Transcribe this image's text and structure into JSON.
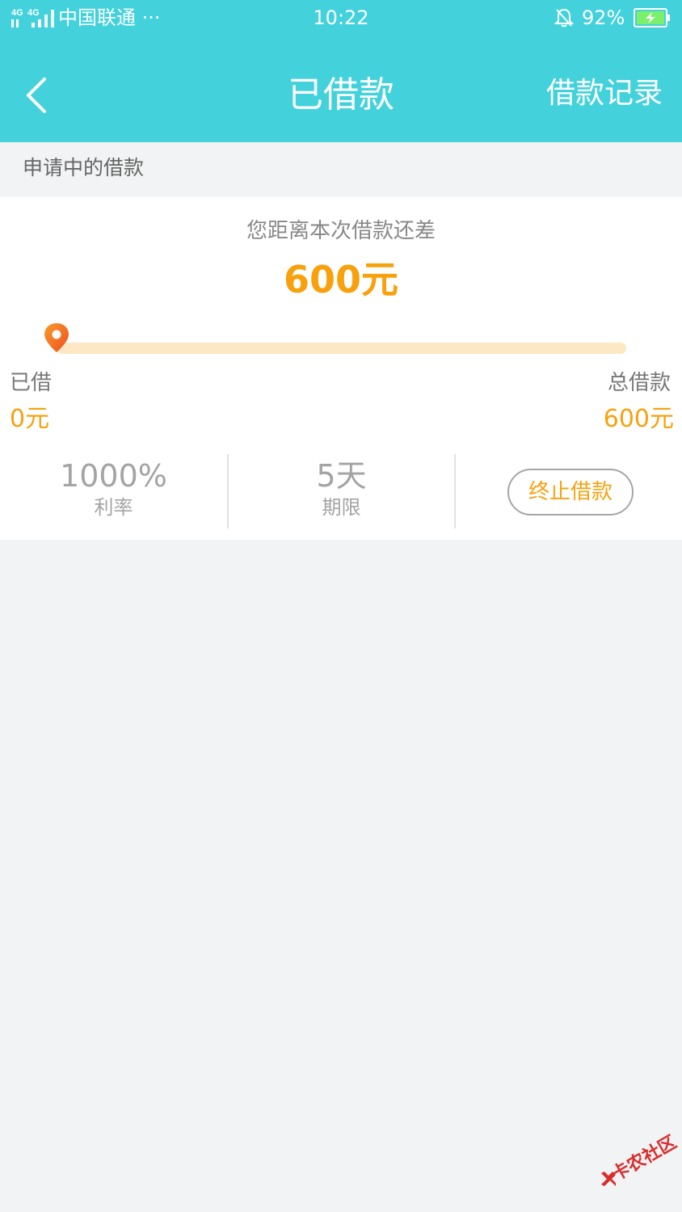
{
  "status_bar": {
    "network": "4G 4G",
    "carrier": "中国联通 ···",
    "time": "10:22",
    "battery": "92%"
  },
  "nav": {
    "title": "已借款",
    "right_link": "借款记录",
    "back_icon": "chevron-left-icon"
  },
  "section": {
    "label": "申请中的借款"
  },
  "loan": {
    "remain_hint": "您距离本次借款还差",
    "remain_amount": "600元",
    "progress_fraction": 0,
    "borrowed_label": "已借",
    "borrowed_value": "0元",
    "total_label": "总借款",
    "total_value": "600元",
    "rate_value": "1000%",
    "rate_label": "利率",
    "term_value": "5天",
    "term_label": "期限",
    "stop_button": "终止借款"
  },
  "watermark": {
    "text": "卡农社区"
  },
  "colors": {
    "header": "#43d2dc",
    "accent": "#f8a10e",
    "track": "#fde8c6",
    "marker": "#f26a21",
    "background": "#f2f3f5"
  }
}
